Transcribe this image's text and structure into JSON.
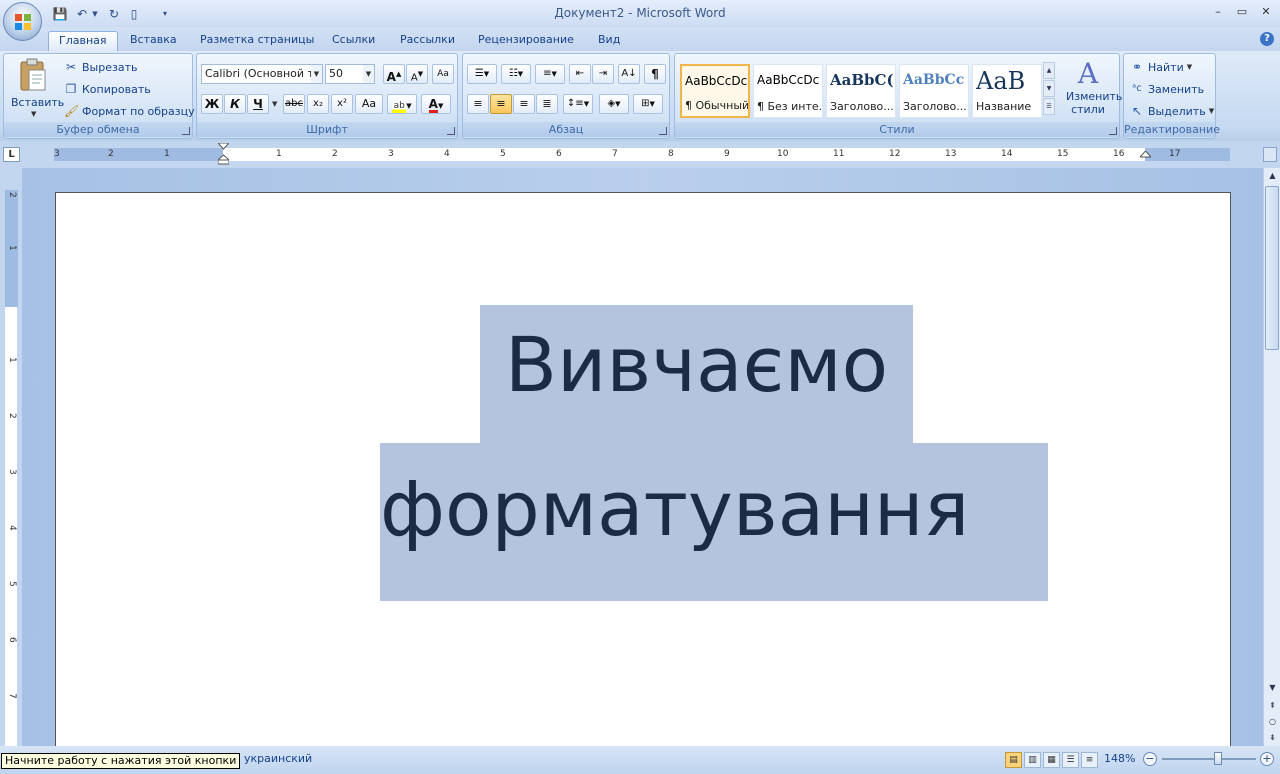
{
  "window": {
    "title": "Документ2 - Microsoft Word",
    "controls": [
      "–",
      "▭",
      "✕"
    ]
  },
  "tabs": [
    "Главная",
    "Вставка",
    "Разметка страницы",
    "Ссылки",
    "Рассылки",
    "Рецензирование",
    "Вид"
  ],
  "active_tab": "Главная",
  "clipboard": {
    "paste": "Вставить",
    "cut": "Вырезать",
    "copy": "Копировать",
    "format_painter": "Формат по образцу",
    "label": "Буфер обмена"
  },
  "font": {
    "name": "Calibri (Основной те",
    "size": "50",
    "bold": "Ж",
    "italic": "К",
    "underline": "Ч",
    "strike": "abc",
    "subscript": "x₂",
    "superscript": "x²",
    "change_case": "Aa",
    "label": "Шрифт"
  },
  "paragraph": {
    "label": "Абзац",
    "pilcrow": "¶"
  },
  "styles": {
    "label": "Стили",
    "items": [
      {
        "sample": "AaBbCcDc",
        "name": "¶ Обычный"
      },
      {
        "sample": "AaBbCcDc",
        "name": "¶ Без инте..."
      },
      {
        "sample": "AaBbC(",
        "name": "Заголово..."
      },
      {
        "sample": "AaBbCc",
        "name": "Заголово..."
      },
      {
        "sample": "AaB",
        "name": "Название"
      }
    ],
    "change_styles": "Изменить стили",
    "selected_index": 0
  },
  "editing": {
    "label": "Редактирование",
    "find": "Найти",
    "replace": "Заменить",
    "select": "Выделить"
  },
  "ruler": {
    "marks": [
      "3",
      "2",
      "1",
      "1",
      "2",
      "3",
      "4",
      "5",
      "6",
      "7",
      "8",
      "9",
      "10",
      "11",
      "12",
      "13",
      "14",
      "15",
      "16",
      "17"
    ],
    "vmarks": [
      "2",
      "1",
      "1",
      "2",
      "3",
      "4",
      "5",
      "6",
      "7"
    ]
  },
  "document": {
    "lines": [
      "Вивчаємо",
      "форматування"
    ]
  },
  "status": {
    "tooltip": "Начните работу с нажатия этой кнопки",
    "language": "украинский",
    "zoom": "148%",
    "zoom_fraction": 0.6
  },
  "colors": {
    "selection": "#b5c4de",
    "text": "#1b2a45",
    "ribbon": "#c5d9f1"
  }
}
